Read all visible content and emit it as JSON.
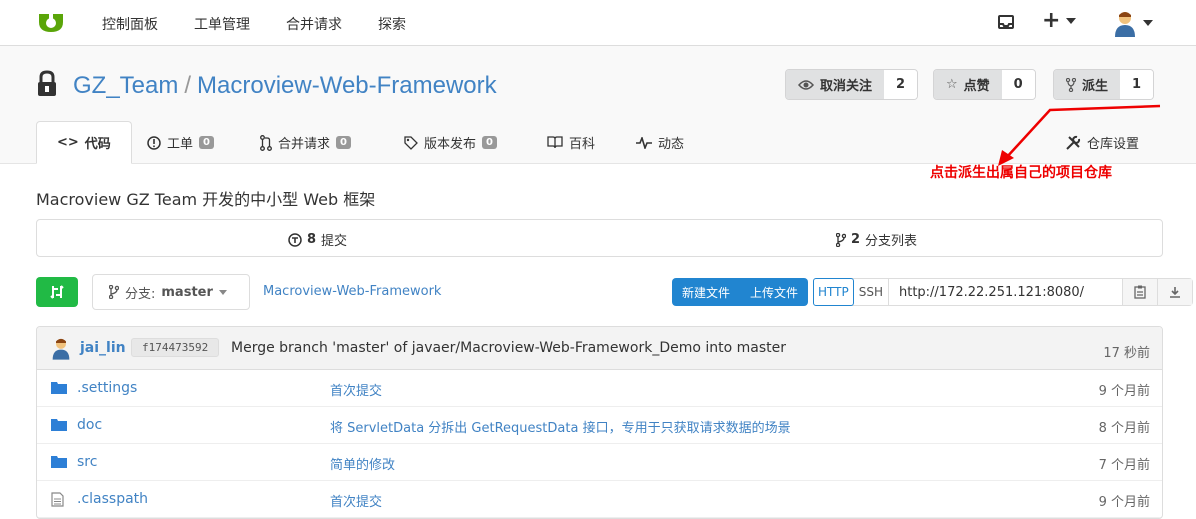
{
  "nav": {
    "items": [
      "控制面板",
      "工单管理",
      "合并请求",
      "探索"
    ]
  },
  "repo": {
    "owner": "GZ_Team",
    "separator": "/",
    "name": "Macroview-Web-Framework",
    "description": "Macroview GZ Team 开发的中小型 Web 框架"
  },
  "actions": {
    "unwatch_label": "取消关注",
    "unwatch_count": "2",
    "star_label": "点赞",
    "star_count": "0",
    "fork_label": "派生",
    "fork_count": "1"
  },
  "tabs": {
    "code": "代码",
    "issues": "工单",
    "issues_count": "0",
    "pulls": "合并请求",
    "pulls_count": "0",
    "releases": "版本发布",
    "releases_count": "0",
    "wiki": "百科",
    "activity": "动态",
    "settings": "仓库设置"
  },
  "annotation": "点击派生出属自己的项目仓库",
  "stats": {
    "commits_num": "8",
    "commits_label": "提交",
    "branches_num": "2",
    "branches_label": "分支列表"
  },
  "toolbar": {
    "branch_prefix": "分支:",
    "branch": "master",
    "breadcrumb": "Macroview-Web-Framework",
    "new_file": "新建文件",
    "upload_file": "上传文件",
    "http": "HTTP",
    "ssh": "SSH",
    "clone_url": "http://172.22.251.121:8080/"
  },
  "latest_commit": {
    "author": "jai_lin",
    "sha": "f174473592",
    "message": "Merge branch 'master' of javaer/Macroview-Web-Framework_Demo into master",
    "time": "17 秒前"
  },
  "files": [
    {
      "name": ".settings",
      "type": "folder",
      "message": "首次提交",
      "time": "9 个月前"
    },
    {
      "name": "doc",
      "type": "folder",
      "message": "将 ServletData 分拆出 GetRequestData 接口，专用于只获取请求数据的场景",
      "time": "8 个月前"
    },
    {
      "name": "src",
      "type": "folder",
      "message": "简单的修改",
      "time": "7 个月前"
    },
    {
      "name": ".classpath",
      "type": "file",
      "message": "首次提交",
      "time": "9 个月前"
    }
  ],
  "colors": {
    "link": "#4183c4",
    "primary": "#2185d0",
    "success": "#21ba45",
    "annotation": "#e00000"
  }
}
